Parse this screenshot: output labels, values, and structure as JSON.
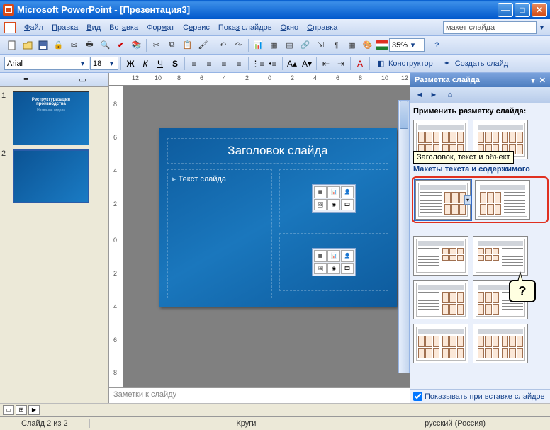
{
  "app": {
    "title": "Microsoft PowerPoint - [Презентация3]"
  },
  "menu": {
    "file": "Файл",
    "edit": "Правка",
    "view": "Вид",
    "insert": "Вставка",
    "format": "Формат",
    "tools": "Сервис",
    "slideshow": "Показ слайдов",
    "window": "Окно",
    "help": "Справка",
    "ask_placeholder": "макет слайда"
  },
  "fmt": {
    "font": "Arial",
    "size": "18",
    "zoom": "35%"
  },
  "buttons": {
    "designer": "Конструктор",
    "newslide": "Создать слайд"
  },
  "ruler": {
    "hticks": [
      "12",
      "10",
      "8",
      "6",
      "4",
      "2",
      "0",
      "2",
      "4",
      "6",
      "8",
      "10",
      "12"
    ],
    "vticks": [
      "8",
      "6",
      "4",
      "2",
      "0",
      "2",
      "4",
      "6",
      "8"
    ]
  },
  "thumbs": [
    {
      "n": "1",
      "line1": "Реструктуризация",
      "line2": "производства",
      "line3": "Название отдела"
    },
    {
      "n": "2",
      "line1": "",
      "line2": "",
      "line3": ""
    }
  ],
  "slide": {
    "title": "Заголовок слайда",
    "bullet": "Текст слайда"
  },
  "notes": {
    "placeholder": "Заметки к слайду"
  },
  "taskpane": {
    "title": "Разметка слайда",
    "apply": "Применить разметку слайда:",
    "section": "Макеты текста и содержимого",
    "tooltip": "Заголовок, текст и объект",
    "balloon": "?",
    "show": "Показывать при вставке слайдов"
  },
  "status": {
    "pos": "Слайд 2 из 2",
    "design": "Круги",
    "lang": "русский (Россия)"
  }
}
